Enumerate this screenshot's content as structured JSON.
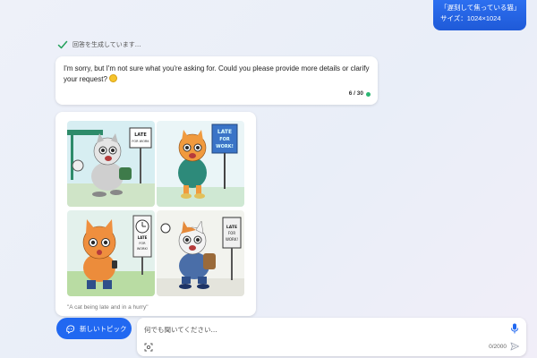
{
  "user_message": {
    "prompt": "「遅刻して焦っている猫」",
    "size_line": "サイズ：1024×1024"
  },
  "status": {
    "text": "回答を生成しています..."
  },
  "assistant_reply": {
    "text": "I'm sorry, but I'm not sure what you're asking for. Could you please provide more details or clarify your request?",
    "counter": "6 / 30"
  },
  "image_result": {
    "sign_text": "LATE FOR WORK!",
    "caption": "\"A cat being late and in a hurry\""
  },
  "composer": {
    "new_topic_label": "新しいトピック",
    "placeholder": "何でも聞いてください...",
    "char_count": "0/2000"
  },
  "colors": {
    "accent": "#2168f1",
    "status_dot": "#2bb673",
    "check": "#22a05a"
  }
}
